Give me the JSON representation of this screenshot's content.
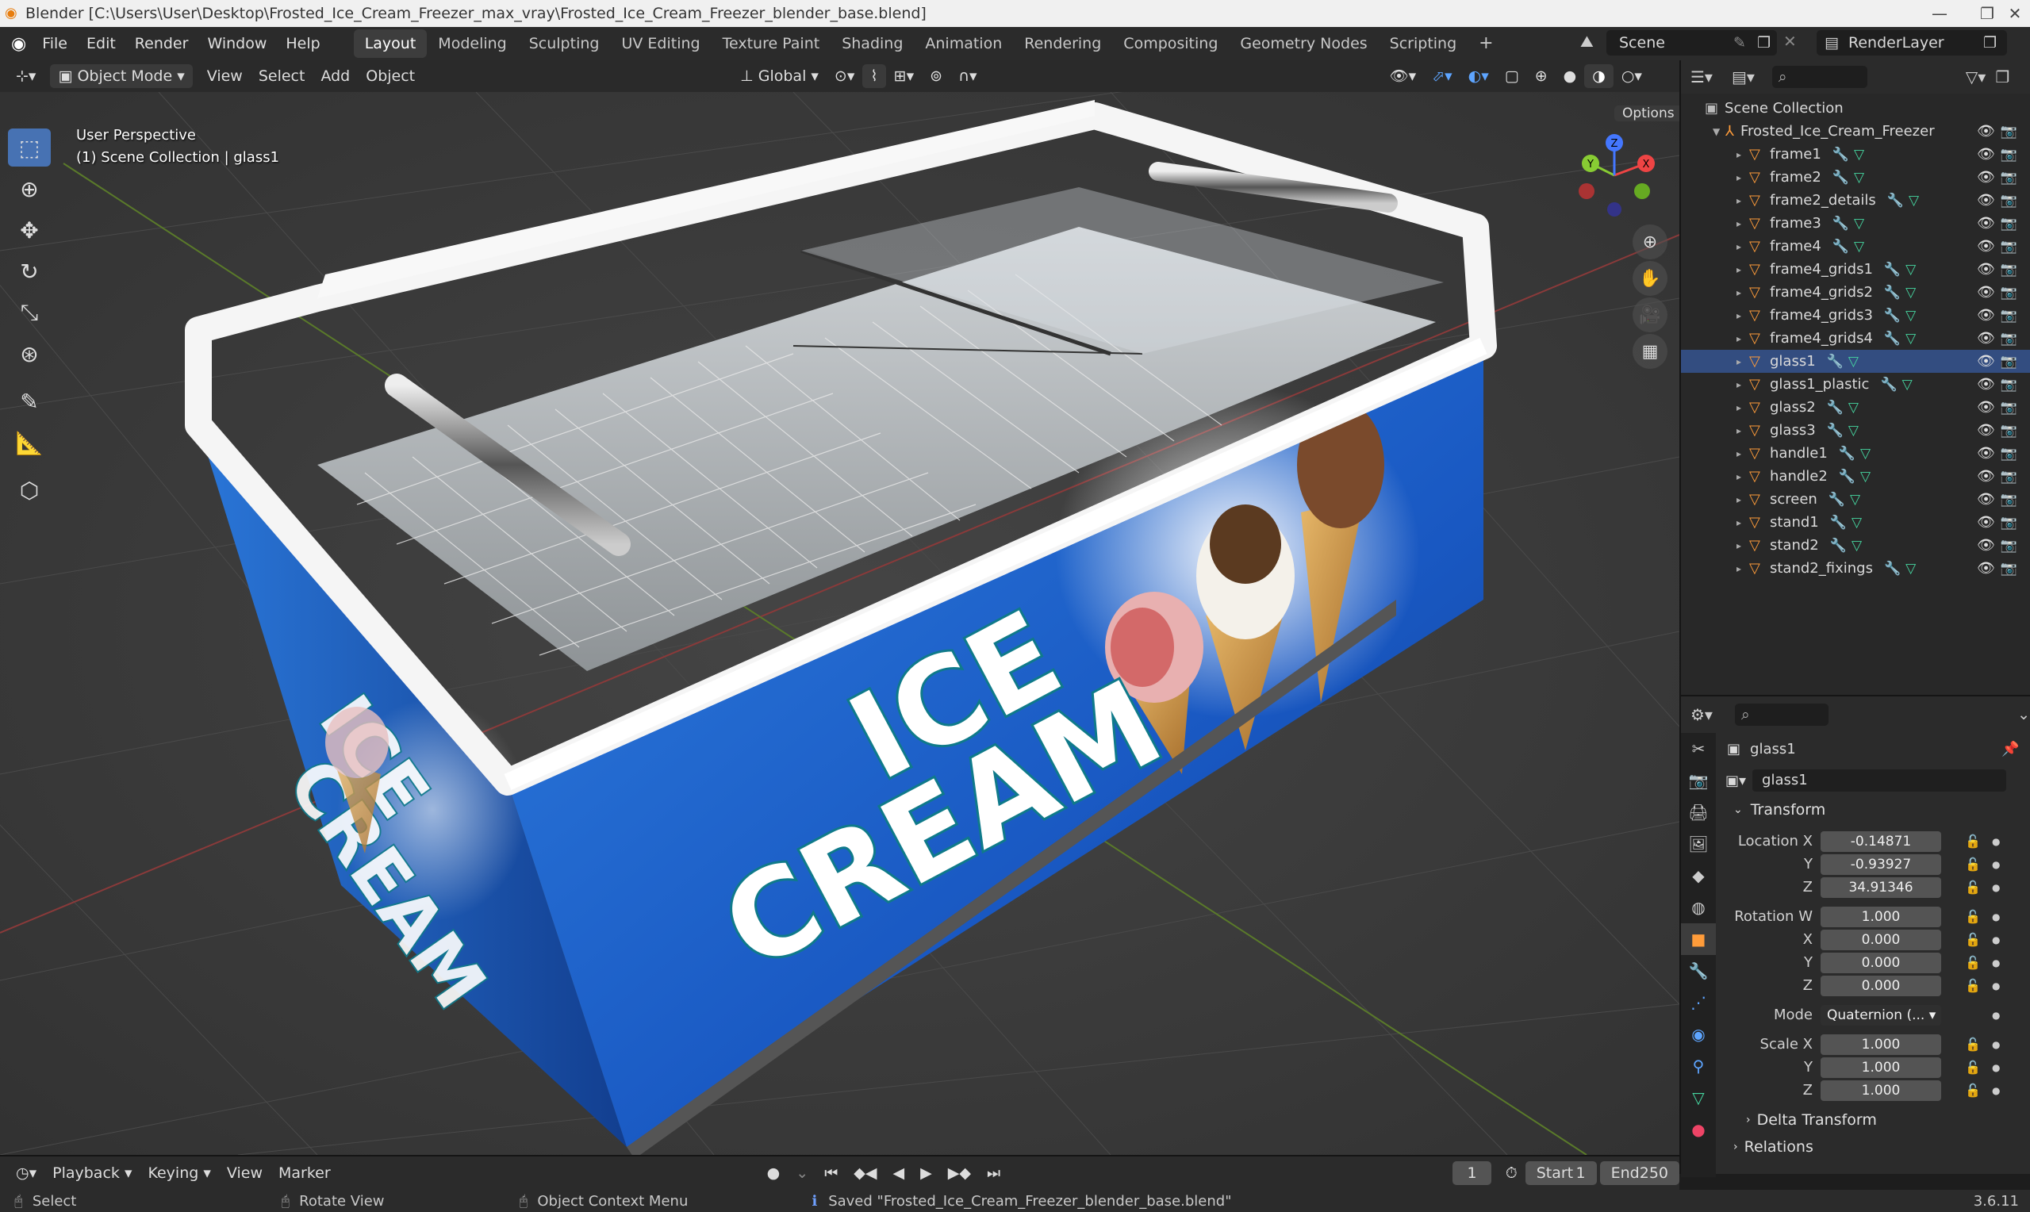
{
  "window": {
    "title": "Blender [C:\\Users\\User\\Desktop\\Frosted_Ice_Cream_Freezer_max_vray\\Frosted_Ice_Cream_Freezer_blender_base.blend]",
    "minimize_icon": "minimize-icon",
    "maximize_icon": "maximize-icon",
    "close_icon": "close-icon"
  },
  "menubar": {
    "items": [
      "File",
      "Edit",
      "Render",
      "Window",
      "Help"
    ],
    "workspaces": [
      "Layout",
      "Modeling",
      "Sculpting",
      "UV Editing",
      "Texture Paint",
      "Shading",
      "Animation",
      "Rendering",
      "Compositing",
      "Geometry Nodes",
      "Scripting"
    ],
    "active_workspace": "Layout",
    "add_workspace": "+",
    "scene": "Scene",
    "render_layer": "RenderLayer"
  },
  "viewport_header": {
    "mode": "Object Mode",
    "menus": [
      "View",
      "Select",
      "Add",
      "Object"
    ],
    "transform_orientation": "Global",
    "options_label": "Options"
  },
  "viewport": {
    "perspective_label": "User Perspective",
    "collection_label": "(1) Scene Collection | glass1",
    "product_text_line1": "ICE",
    "product_text_line2": "CREAM",
    "gizmo_axes": [
      "X",
      "Y",
      "Z"
    ],
    "accent_color": "#4772b3",
    "tools": [
      "select-box-icon",
      "cursor-icon",
      "move-icon",
      "rotate-icon",
      "scale-icon",
      "transform-icon",
      "annotate-icon",
      "measure-icon",
      "add-cube-icon"
    ]
  },
  "outliner": {
    "root": "Scene Collection",
    "collection": "Frosted_Ice_Cream_Freezer",
    "items": [
      {
        "name": "frame1"
      },
      {
        "name": "frame2"
      },
      {
        "name": "frame2_details"
      },
      {
        "name": "frame3"
      },
      {
        "name": "frame4"
      },
      {
        "name": "frame4_grids1"
      },
      {
        "name": "frame4_grids2"
      },
      {
        "name": "frame4_grids3"
      },
      {
        "name": "frame4_grids4"
      },
      {
        "name": "glass1"
      },
      {
        "name": "glass1_plastic"
      },
      {
        "name": "glass2"
      },
      {
        "name": "glass3"
      },
      {
        "name": "handle1"
      },
      {
        "name": "handle2"
      },
      {
        "name": "screen"
      },
      {
        "name": "stand1"
      },
      {
        "name": "stand2"
      },
      {
        "name": "stand2_fixings"
      }
    ],
    "selected": "glass1"
  },
  "properties": {
    "object_name": "glass1",
    "datablock_name": "glass1",
    "transform_label": "Transform",
    "location": {
      "label": "Location X",
      "x": "-0.14871",
      "y": "-0.93927",
      "z": "34.91346"
    },
    "rotation": {
      "label": "Rotation W",
      "w": "1.000",
      "x": "0.000",
      "y": "0.000",
      "z": "0.000"
    },
    "mode": {
      "label": "Mode",
      "value": "Quaternion (..."
    },
    "scale": {
      "label": "Scale X",
      "x": "1.000",
      "y": "1.000",
      "z": "1.000"
    },
    "axis_y": "Y",
    "axis_z": "Z",
    "axis_x": "X",
    "delta_transform": "Delta Transform",
    "relations": "Relations"
  },
  "timeline": {
    "menus": [
      "Playback",
      "Keying",
      "View",
      "Marker"
    ],
    "current_frame": "1",
    "start_label": "Start",
    "start": "1",
    "end_label": "End",
    "end": "250"
  },
  "statusbar": {
    "select": "Select",
    "rotate_view": "Rotate View",
    "context_menu": "Object Context Menu",
    "message": "Saved \"Frosted_Ice_Cream_Freezer_blender_base.blend\"",
    "version": "3.6.11"
  }
}
